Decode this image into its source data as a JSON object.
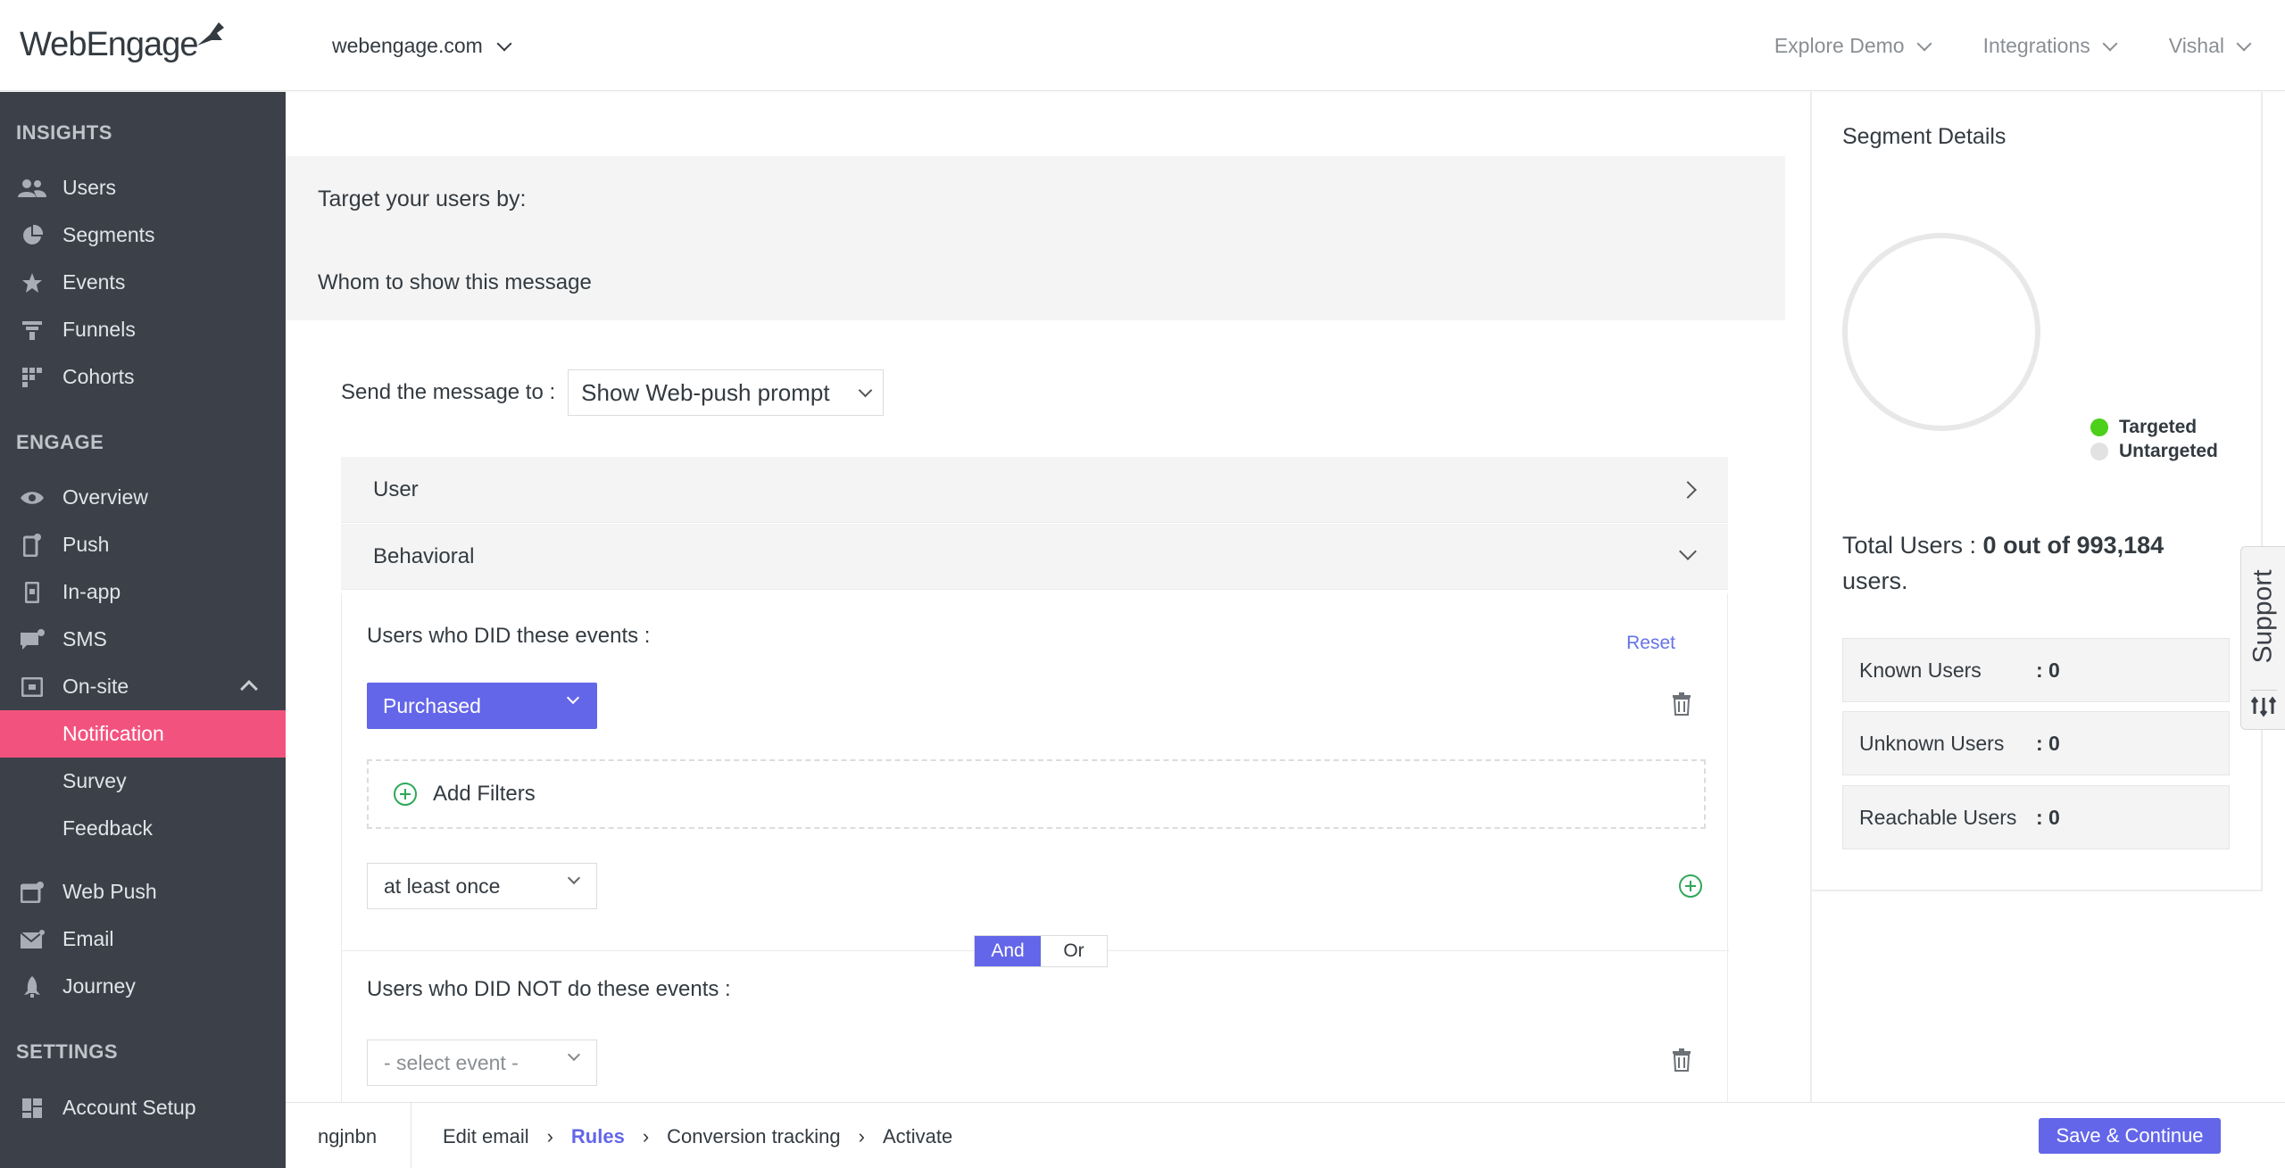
{
  "header": {
    "logo_text": "WebEngage",
    "site": "webengage.com",
    "nav": [
      "Explore Demo",
      "Integrations",
      "Vishal"
    ]
  },
  "sidebar": {
    "sections": [
      {
        "title": "INSIGHTS",
        "items": [
          {
            "label": "Users",
            "icon": "users-icon"
          },
          {
            "label": "Segments",
            "icon": "pie-icon"
          },
          {
            "label": "Events",
            "icon": "star-icon"
          },
          {
            "label": "Funnels",
            "icon": "funnel-icon"
          },
          {
            "label": "Cohorts",
            "icon": "grid-icon"
          }
        ]
      },
      {
        "title": "ENGAGE",
        "items": [
          {
            "label": "Overview",
            "icon": "eye-icon"
          },
          {
            "label": "Push",
            "icon": "phone-icon"
          },
          {
            "label": "In-app",
            "icon": "phone-icon"
          },
          {
            "label": "SMS",
            "icon": "chat-icon"
          },
          {
            "label": "On-site",
            "icon": "window-icon"
          },
          {
            "label": "Notification"
          },
          {
            "label": "Survey"
          },
          {
            "label": "Feedback"
          },
          {
            "label": "Web Push",
            "icon": "browser-icon"
          },
          {
            "label": "Email",
            "icon": "mail-icon"
          },
          {
            "label": "Journey",
            "icon": "rocket-icon"
          }
        ]
      },
      {
        "title": "SETTINGS",
        "items": [
          {
            "label": "Account Setup",
            "icon": "dashboard-icon"
          }
        ]
      }
    ]
  },
  "main": {
    "target_title": "Target your users by:",
    "target_sub": "Whom to show this message",
    "send_label": "Send the message to :",
    "send_value": "Show Web-push prompt",
    "accordion_user": "User",
    "accordion_behavioral": "Behavioral",
    "did_label": "Users who DID these events :",
    "reset": "Reset",
    "event_selected": "Purchased",
    "add_filters": "Add Filters",
    "frequency": "at least once",
    "and": "And",
    "or": "Or",
    "didnot_label": "Users who DID NOT do these events :",
    "select_event_placeholder": "- select event -"
  },
  "segment": {
    "title": "Segment Details",
    "legend_targeted": "Targeted",
    "legend_untargeted": "Untargeted",
    "total_prefix": "Total Users : ",
    "total_value": "0 out of 993,184",
    "total_suffix": "users.",
    "stats": [
      {
        "label": "Known Users",
        "value": ": 0"
      },
      {
        "label": "Unknown Users",
        "value": ": 0"
      },
      {
        "label": "Reachable Users",
        "value": ": 0"
      }
    ],
    "colors": {
      "targeted": "#4cd01b",
      "untargeted": "#e2e2e2"
    }
  },
  "support": {
    "label": "Support"
  },
  "footer": {
    "campaign_name": "ngjnbn",
    "steps": [
      "Edit email",
      "Rules",
      "Conversion tracking",
      "Activate"
    ],
    "active_step": "Rules",
    "save": "Save & Continue"
  },
  "colors": {
    "accent": "#6366e8",
    "sidebar_bg": "#3c4049",
    "active_item": "#f2537e"
  }
}
